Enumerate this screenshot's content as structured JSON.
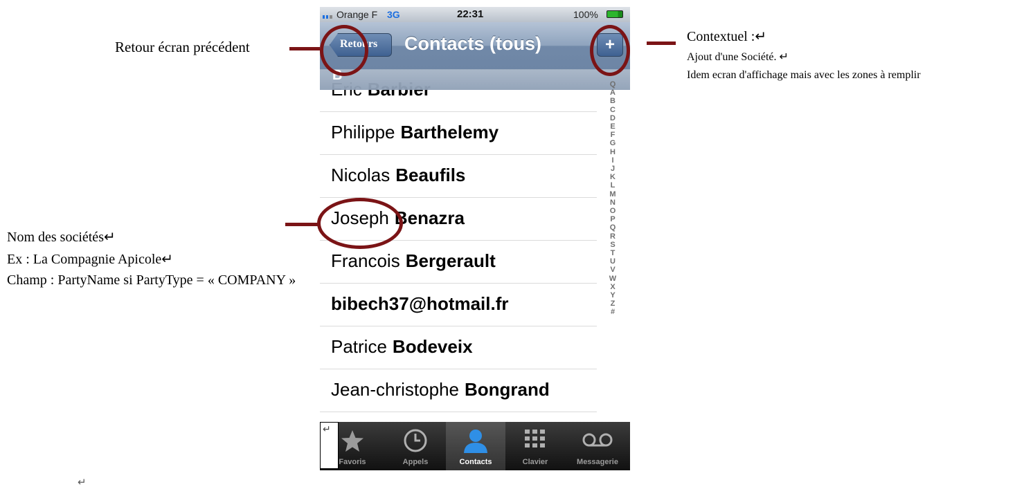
{
  "annotations": {
    "back_label": "Retour écran précédent",
    "context_title": "Contextuel :↵",
    "context_line1": "Ajout d'une Société. ↵",
    "context_line2": "Idem ecran d'affichage mais avec les zones à remplir",
    "company_line1": "Nom des sociétés↵",
    "company_line2": "Ex : La Compagnie Apicole↵",
    "company_line3": "Champ : PartyName si PartyType = « COMPANY »",
    "return_mark": "↵",
    "tabbar_return_mark": "↵"
  },
  "status_bar": {
    "carrier": "Orange F",
    "network": "3G",
    "time": "22:31",
    "battery": "100%"
  },
  "nav_bar": {
    "back_button": "Retours",
    "title": "Contacts (tous)",
    "add_button": "+"
  },
  "section_header": "B",
  "contacts": [
    {
      "first": "Eric",
      "last": "Barbier"
    },
    {
      "first": "Philippe",
      "last": "Barthelemy"
    },
    {
      "first": "Nicolas",
      "last": "Beaufils"
    },
    {
      "first": "Joseph",
      "last": "Benazra"
    },
    {
      "first": "Francois",
      "last": "Bergerault"
    },
    {
      "first": "",
      "last": "bibech37@hotmail.fr"
    },
    {
      "first": "Patrice",
      "last": "Bodeveix"
    },
    {
      "first": "Jean-christophe",
      "last": "Bongrand"
    }
  ],
  "index_letters": [
    "Q",
    "A",
    "B",
    "C",
    "D",
    "E",
    "F",
    "G",
    "H",
    "I",
    "J",
    "K",
    "L",
    "M",
    "N",
    "O",
    "P",
    "Q",
    "R",
    "S",
    "T",
    "U",
    "V",
    "W",
    "X",
    "Y",
    "Z",
    "#"
  ],
  "tabs": [
    {
      "label": "Favoris",
      "icon": "star-icon"
    },
    {
      "label": "Appels",
      "icon": "clock-icon"
    },
    {
      "label": "Contacts",
      "icon": "person-icon"
    },
    {
      "label": "Clavier",
      "icon": "keypad-icon"
    },
    {
      "label": "Messagerie",
      "icon": "voicemail-icon"
    }
  ],
  "colors": {
    "annotation_red": "#7b1416",
    "nav_bar_blue": "#6d85a5",
    "network_blue": "#1d6fe0",
    "tab_active_blue": "#2f8fe6"
  }
}
